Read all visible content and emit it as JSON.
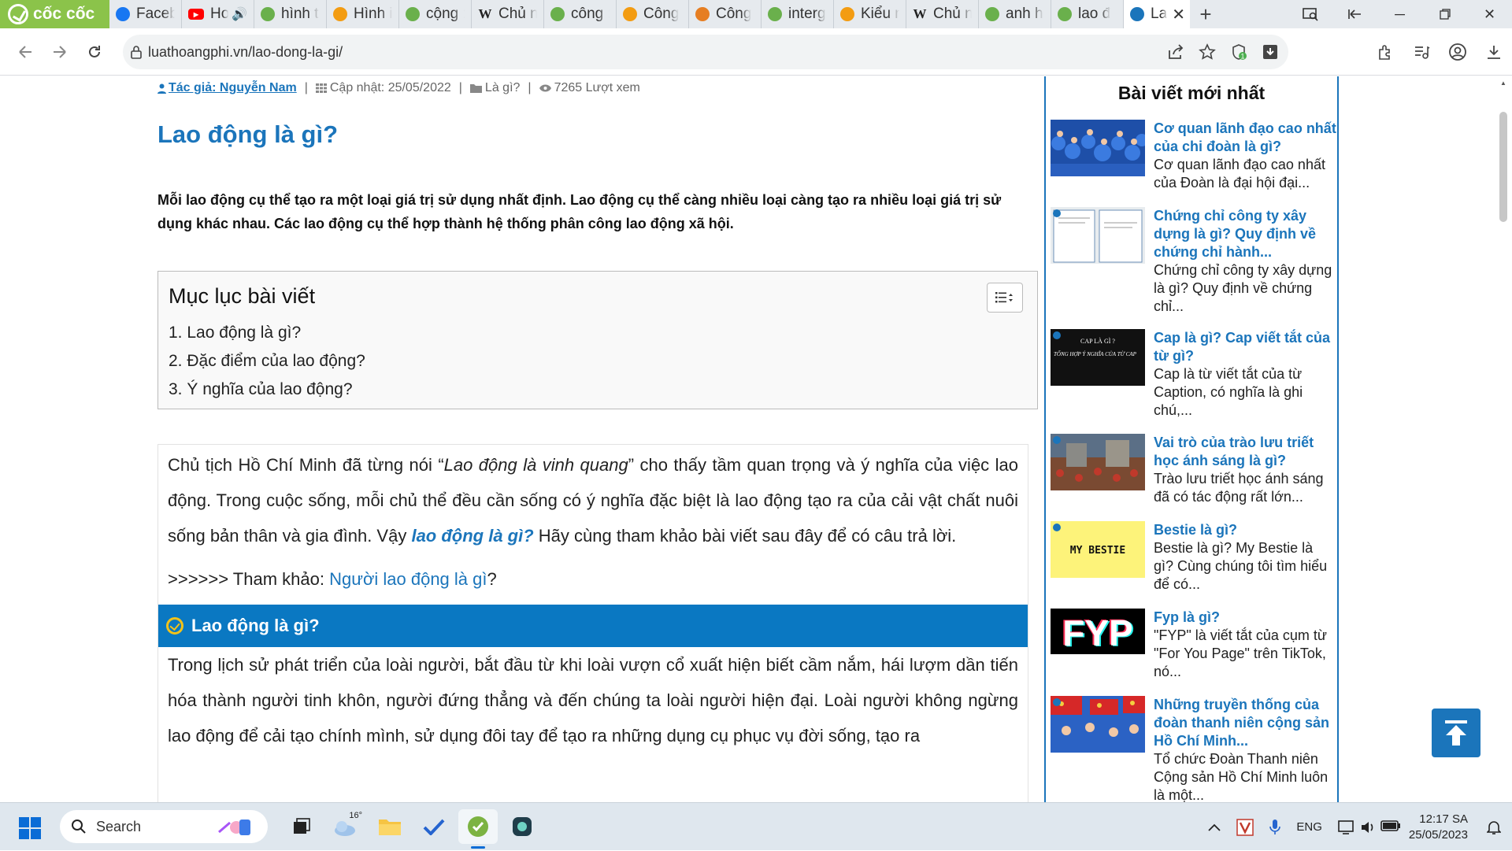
{
  "browser": {
    "brand": "cốc cốc",
    "tabs": [
      {
        "label": "Faceb",
        "icon": "facebook-icon",
        "color": "#1877f2"
      },
      {
        "label": "Ho",
        "icon": "youtube-icon",
        "color": "#ff0000"
      },
      {
        "label": "hình t",
        "icon": "coccoc-icon",
        "color": "#6ab04c"
      },
      {
        "label": "Hình i",
        "icon": "site-icon",
        "color": "#f39c12"
      },
      {
        "label": "cộng :",
        "icon": "coccoc-icon",
        "color": "#6ab04c"
      },
      {
        "label": "Chủ n",
        "icon": "wikipedia-icon",
        "color": "#333333"
      },
      {
        "label": "công :",
        "icon": "coccoc-icon",
        "color": "#6ab04c"
      },
      {
        "label": "Công",
        "icon": "site-icon",
        "color": "#f39c12"
      },
      {
        "label": "Công",
        "icon": "emoji-icon",
        "color": "#e67e22"
      },
      {
        "label": "interg",
        "icon": "coccoc-icon",
        "color": "#6ab04c"
      },
      {
        "label": "Kiểu n",
        "icon": "site-icon",
        "color": "#f39c12"
      },
      {
        "label": "Chủ n",
        "icon": "wikipedia-icon",
        "color": "#333333"
      },
      {
        "label": "anh h",
        "icon": "coccoc-icon",
        "color": "#6ab04c"
      },
      {
        "label": "lao đ",
        "icon": "coccoc-icon",
        "color": "#6ab04c"
      },
      {
        "label": "La",
        "icon": "luathoangphi-icon",
        "color": "#1b75bb",
        "active": true
      }
    ],
    "url": "luathoangphi.vn/lao-dong-la-gi/"
  },
  "article": {
    "meta": {
      "author": "Tác giả: Nguyễn Nam",
      "updated": "Cập nhật: 25/05/2022",
      "category": "Là gì?",
      "views": "7265 Lượt xem"
    },
    "title": "Lao động là gì?",
    "lead": "Mỗi lao động cụ thể tạo ra một loại giá trị sử dụng nhất định. Lao động cụ thể càng nhiều loại càng tạo ra nhiều loại giá trị sử dụng khác nhau. Các lao động cụ thể hợp thành hệ thống phân công lao động xã hội.",
    "toc": {
      "heading": "Mục lục bài viết",
      "items": [
        "1. Lao động là gì?",
        "2. Đặc điểm của lao động?",
        "3. Ý nghĩa của lao động?"
      ]
    },
    "intro": {
      "part1": "Chủ tịch Hồ Chí Minh đã từng nói “",
      "quote": "Lao động là vinh quang",
      "part2": "” cho thấy tầm quan trọng và ý nghĩa của việc lao động. Trong cuộc sống, mỗi chủ thể đều cần sống có ý nghĩa đặc biệt là lao động tạo ra của cải vật chất nuôi sống bản thân và gia đình. Vậy ",
      "keyword": "lao động là gì?",
      "part3": " Hãy cùng tham khảo bài viết sau đây để có câu trả lời."
    },
    "reference": {
      "prefix": ">>>>>> Tham khảo: ",
      "link": "Người lao động là gì",
      "suffix": "?"
    },
    "section_heading": "Lao động là gì?",
    "section_text": "Trong lịch sử phát triển của loài người, bắt đầu từ khi loài vượn cổ xuất hiện biết cầm nắm, hái lượm dần tiến hóa thành người tinh khôn, người đứng thẳng và đến chúng ta loài người hiện đại. Loài người không ngừng lao động để cải tạo chính mình, sử dụng đôi tay để tạo ra những dụng cụ phục vụ đời sống, tạo ra"
  },
  "sidebar": {
    "heading": "Bài viết mới nhất",
    "posts": [
      {
        "title": "Cơ quan lãnh đạo cao nhất của chi đoàn là gì?",
        "excerpt": "Cơ quan lãnh đạo cao nhất của Đoàn là đại hội đại...",
        "thumb": "crowd-blue"
      },
      {
        "title": "Chứng chỉ công ty xây dựng là gì? Quy định về chứng chỉ hành...",
        "excerpt": "Chứng chỉ công ty xây dựng là gì? Quy định về chứng chỉ...",
        "thumb": "document"
      },
      {
        "title": "Cap là gì? Cap viết tắt của từ gì?",
        "excerpt": "Cap là từ viết tắt của từ Caption, có nghĩa là ghi chú,...",
        "thumb": "black-card"
      },
      {
        "title": "Vai trò của trào lưu triết học ánh sáng là gì?",
        "excerpt": "Trào lưu triết học ánh sáng đã có tác động rất lớn...",
        "thumb": "painting"
      },
      {
        "title": "Bestie là gì?",
        "excerpt": "Bestie là gì? My Bestie là gì? Cùng chúng tôi tìm hiểu để có...",
        "thumb": "bestie"
      },
      {
        "title": "Fyp là gì?",
        "excerpt": "\"FYP\" là viết tắt của cụm từ \"For You Page\" trên TikTok, nó...",
        "thumb": "fyp"
      },
      {
        "title": "Những truyền thống của đoàn thanh niên cộng sản Hồ Chí Minh...",
        "excerpt": "Tổ chức Đoàn Thanh niên Cộng sản Hồ Chí Minh luôn là một...",
        "thumb": "flags"
      }
    ],
    "thumb_text": {
      "cap_title": "CAP LÀ GÌ ?",
      "cap_sub": "TỔNG HỢP Ý NGHĨA CỦA TỪ CAP",
      "bestie": "MY BESTIE",
      "fyp": "FYP"
    }
  },
  "taskbar": {
    "search_label": "Search",
    "weather": "16°",
    "language": "ENG",
    "time": "12:17 SA",
    "date": "25/05/2023"
  },
  "colors": {
    "accent": "#1b75bb",
    "section_bar": "#0a78c2",
    "brand_green": "#8bc34a"
  }
}
